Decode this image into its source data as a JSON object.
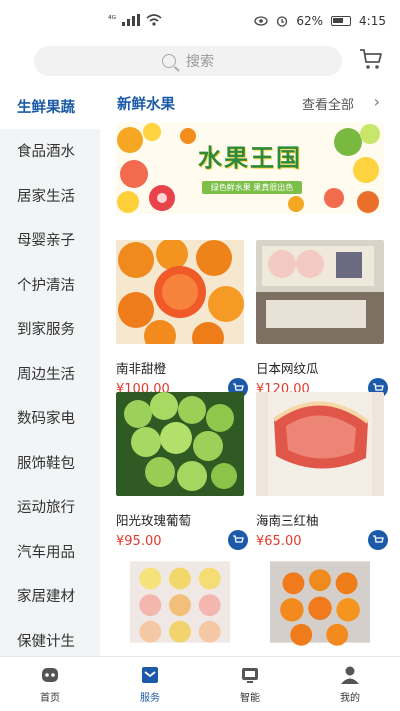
{
  "status_bar": {
    "signal_tag": "⁴ᴳ",
    "battery_percent": "62%",
    "time": "4:15"
  },
  "search": {
    "placeholder": "搜索",
    "icon": "search-icon",
    "cart_icon": "cart-icon"
  },
  "sidebar": {
    "items": [
      {
        "label": "生鲜果蔬",
        "active": true
      },
      {
        "label": "食品酒水"
      },
      {
        "label": "居家生活"
      },
      {
        "label": "母婴亲子"
      },
      {
        "label": "个护清洁"
      },
      {
        "label": "到家服务"
      },
      {
        "label": "周边生活"
      },
      {
        "label": "数码家电"
      },
      {
        "label": "服饰鞋包"
      },
      {
        "label": "运动旅行"
      },
      {
        "label": "汽车用品"
      },
      {
        "label": "家居建材"
      },
      {
        "label": "保健计生"
      }
    ]
  },
  "main": {
    "category_title": "新鲜水果",
    "view_all": "查看全部",
    "banner": {
      "title": "水果王国",
      "subtitle": "绿色鲜水果 果真很出色"
    },
    "products": [
      {
        "name": "南非甜橙",
        "price": "¥100.00"
      },
      {
        "name": "日本网纹瓜",
        "price": "¥120.00"
      },
      {
        "name": "阳光玫瑰葡萄",
        "price": "¥95.00"
      },
      {
        "name": "海南三红柚",
        "price": "¥65.00"
      }
    ]
  },
  "bottom_nav": {
    "items": [
      {
        "label": "首页",
        "icon": "home-icon"
      },
      {
        "label": "服务",
        "icon": "service-icon",
        "active": true
      },
      {
        "label": "智能",
        "icon": "smart-icon"
      },
      {
        "label": "我的",
        "icon": "profile-icon"
      }
    ]
  },
  "colors": {
    "accent": "#1a5aa8",
    "price": "#e33a2a",
    "sidebar_bg": "#f2f4f6"
  }
}
